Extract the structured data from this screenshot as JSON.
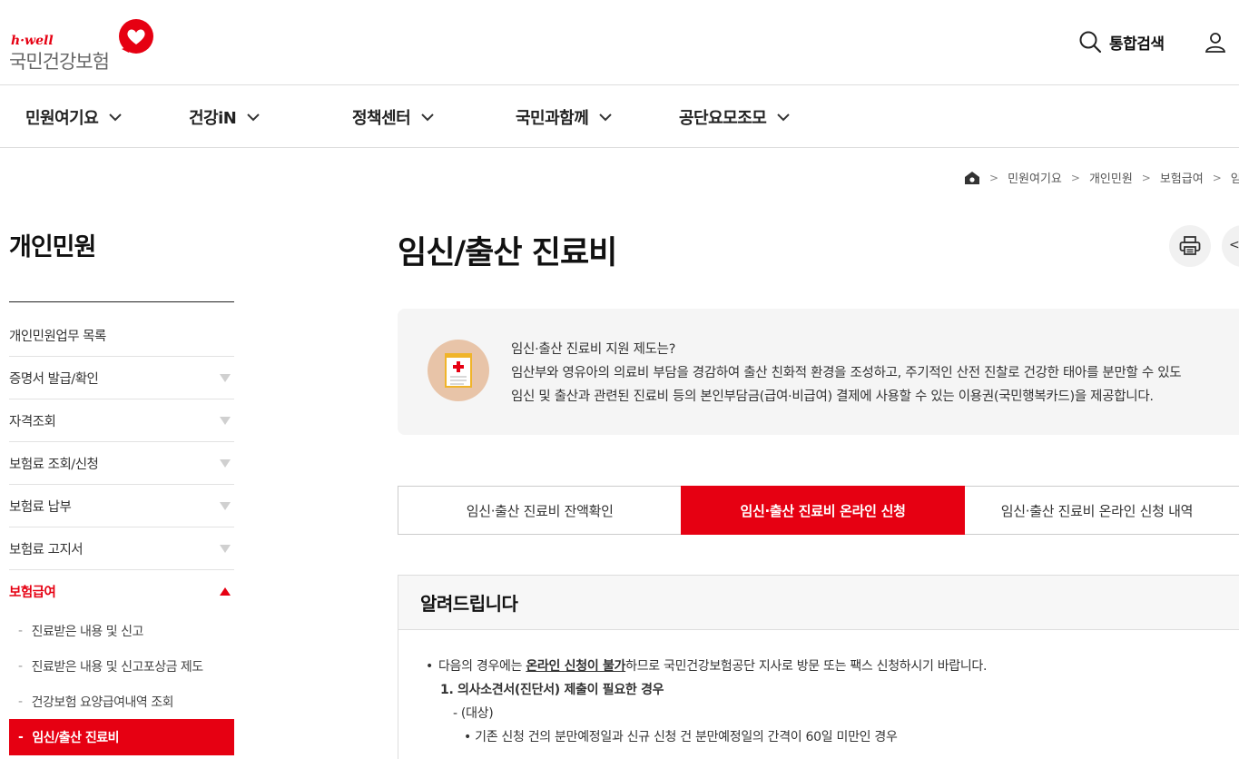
{
  "header": {
    "logo_small": "h·well",
    "logo_main": "국민건강보험",
    "search_label": "통합검색"
  },
  "gnb": {
    "items": [
      {
        "label": "민원여기요"
      },
      {
        "label": "건강iN"
      },
      {
        "label": "정책센터"
      },
      {
        "label": "국민과함께"
      },
      {
        "label": "공단요모조모"
      }
    ]
  },
  "breadcrumb": {
    "items": [
      "민원여기요",
      "개인민원",
      "보험급여",
      "임"
    ]
  },
  "sidebar": {
    "title": "개인민원",
    "items": [
      {
        "label": "개인민원업무 목록"
      },
      {
        "label": "증명서 발급/확인"
      },
      {
        "label": "자격조회"
      },
      {
        "label": "보험료 조회/신청"
      },
      {
        "label": "보험료 납부"
      },
      {
        "label": "보험료 고지서"
      },
      {
        "label": "보험급여"
      }
    ],
    "sub_items": [
      {
        "label": "진료받은 내용 및 신고"
      },
      {
        "label": "진료받은 내용 및 신고포상금 제도"
      },
      {
        "label": "건강보험 요양급여내역 조회"
      },
      {
        "label": "임신/출산 진료비"
      }
    ],
    "dash": "-"
  },
  "main": {
    "title": "임신/출산 진료비",
    "intro": {
      "line1": "임신·출산 진료비 지원 제도는?",
      "line2": "임산부와 영유아의 의료비 부담을 경감하여 출산 친화적 환경을 조성하고, 주기적인 산전 진찰로 건강한 태아를 분만할 수 있도",
      "line3": "임신 및 출산과 관련된 진료비 등의 본인부담금(급여·비급여) 결제에 사용할 수 있는 이용권(국민행복카드)을 제공합니다."
    },
    "tabs": [
      {
        "label": "임신·출산 진료비 잔액확인"
      },
      {
        "label": "임신·출산 진료비 온라인 신청"
      },
      {
        "label": "임신·출산 진료비 온라인 신청 내역"
      }
    ],
    "notice": {
      "heading": "알려드립니다",
      "l1_bullet": "•",
      "l1_pre": "다음의 경우에는 ",
      "l1_em": "온라인 신청이 불가",
      "l1_post": "하므로 국민건강보험공단 지사로 방문 또는 팩스 신청하시기 바랍니다.",
      "l2": "1. 의사소견서(진단서) 제출이 필요한 경우",
      "l3": "- (대상)",
      "l4": "• 기존 신청 건의 분만예정일과 신규 신청 건 분만예정일의 간격이 60일 미만인 경우"
    }
  },
  "colors": {
    "brand_red": "#e60012"
  }
}
